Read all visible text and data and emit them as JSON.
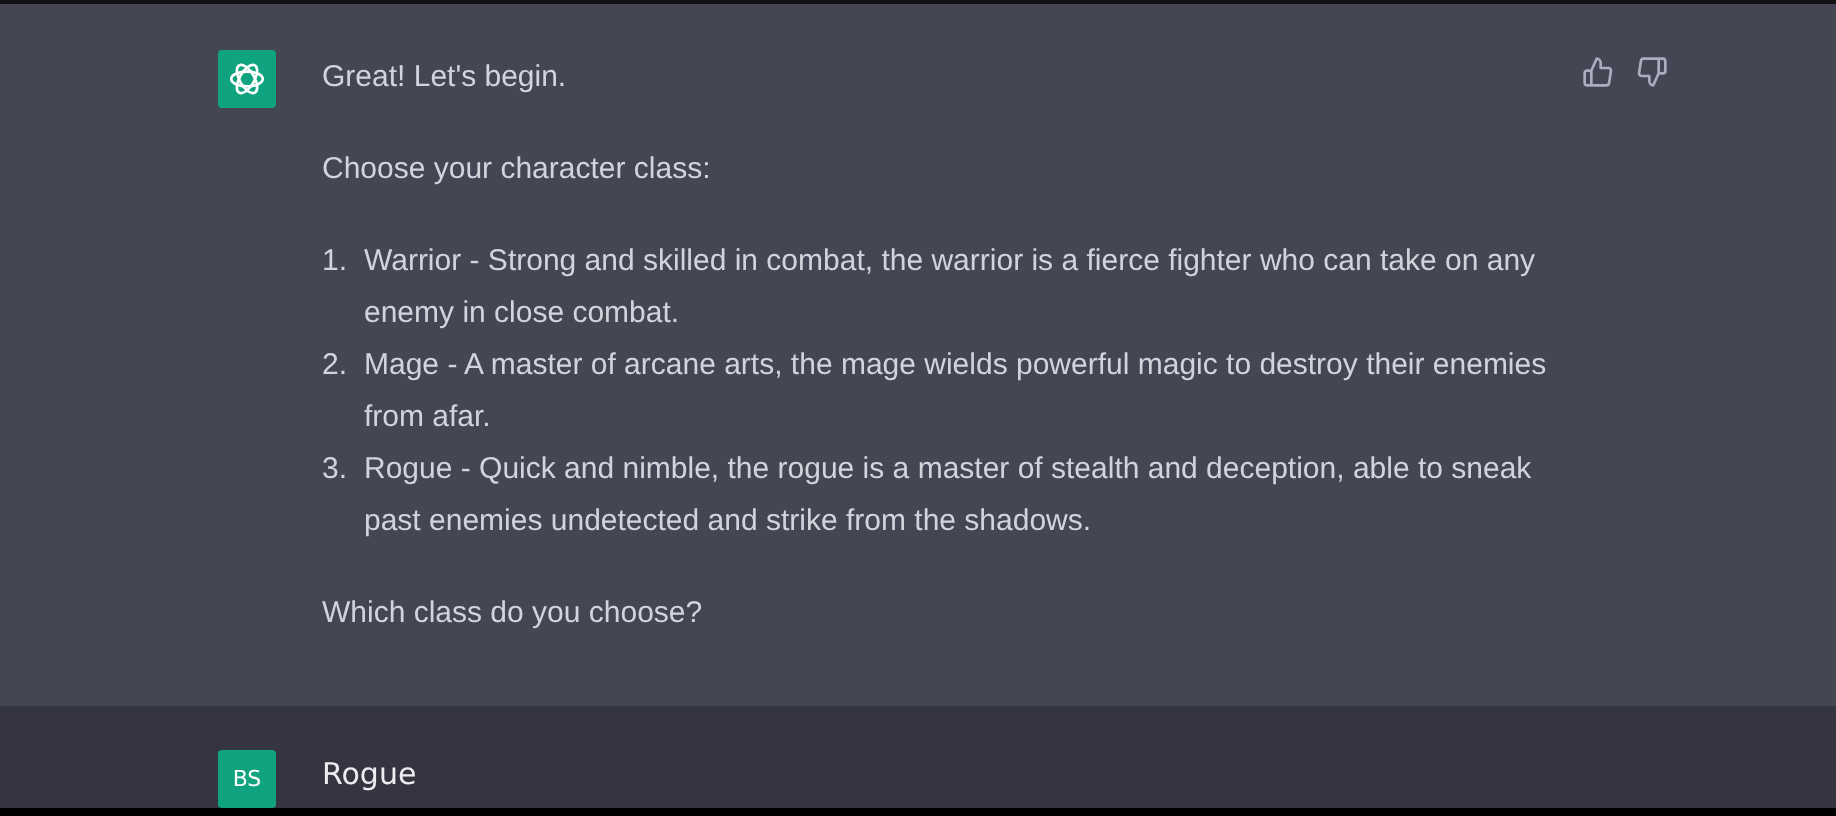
{
  "assistant_message": {
    "intro": "Great! Let's begin.",
    "prompt": "Choose your character class:",
    "options": [
      {
        "number": "1.",
        "text": "Warrior - Strong and skilled in combat, the warrior is a fierce fighter who can take on any enemy in close combat."
      },
      {
        "number": "2.",
        "text": "Mage - A master of arcane arts, the mage wields powerful magic to destroy their enemies from afar."
      },
      {
        "number": "3.",
        "text": "Rogue - Quick and nimble, the rogue is a master of stealth and deception, able to sneak past enemies undetected and strike from the shadows."
      }
    ],
    "question": "Which class do you choose?"
  },
  "user_message": {
    "avatar": "BS",
    "text": "Rogue"
  }
}
